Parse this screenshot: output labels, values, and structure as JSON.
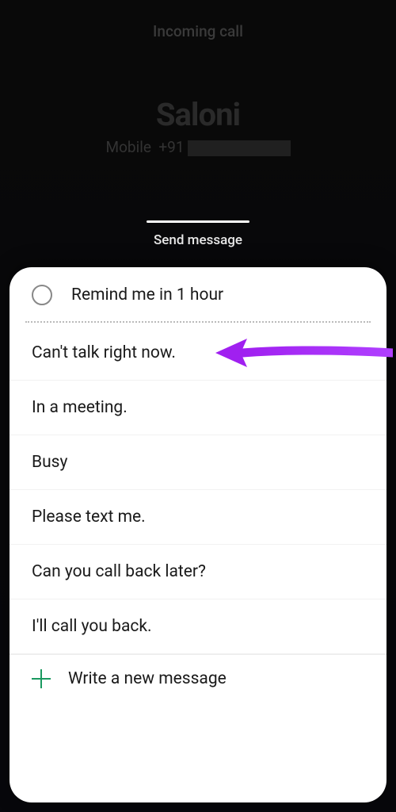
{
  "header": {
    "incoming_label": "Incoming call",
    "caller_name": "Saloni",
    "number_type": "Mobile",
    "number_prefix": "+91"
  },
  "send_message": {
    "label": "Send message"
  },
  "remind": {
    "label": "Remind me in 1 hour"
  },
  "options": {
    "0": "Can't talk right now.",
    "1": "In a meeting.",
    "2": "Busy",
    "3": "Please text me.",
    "4": "Can you call back later?",
    "5": "I'll call you back."
  },
  "write": {
    "label": "Write a new message"
  },
  "annotation": {
    "arrow_color": "#a020f0"
  }
}
